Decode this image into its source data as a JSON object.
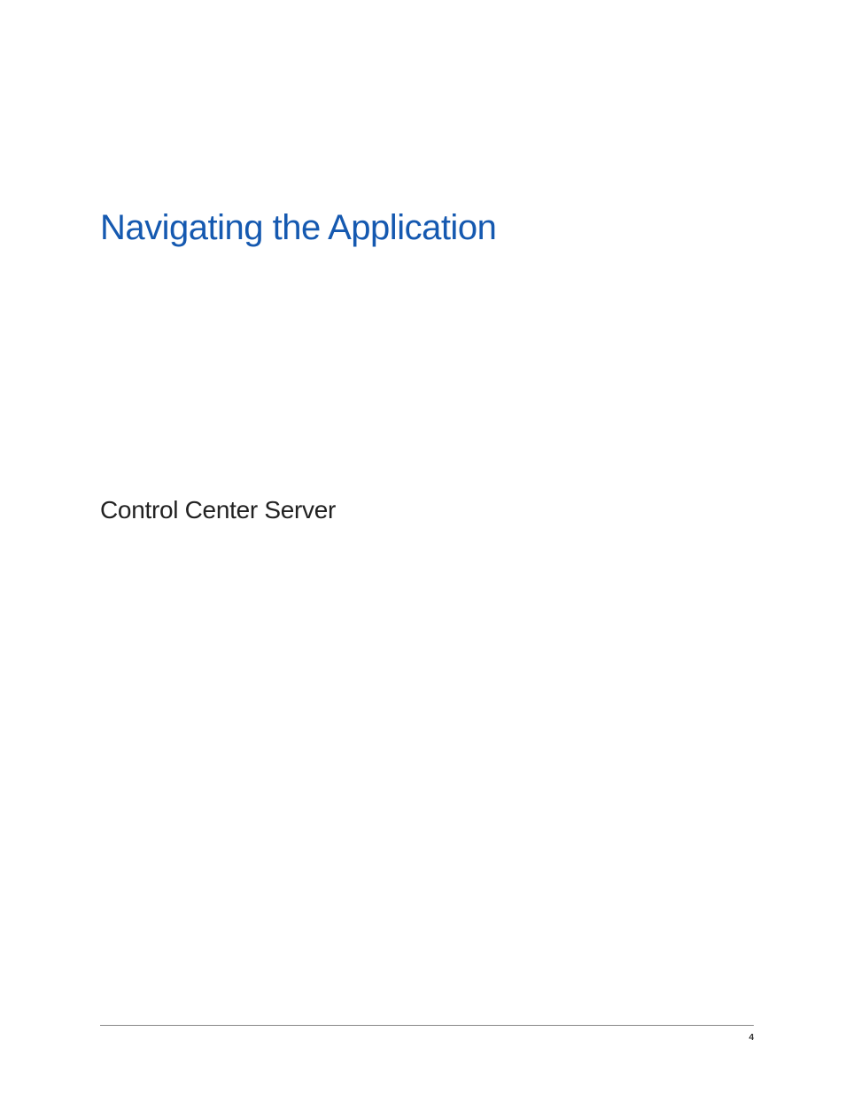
{
  "chapter": {
    "title": "Navigating the Application"
  },
  "section": {
    "heading": "Control Center Server"
  },
  "footer": {
    "pageNumber": "4"
  }
}
